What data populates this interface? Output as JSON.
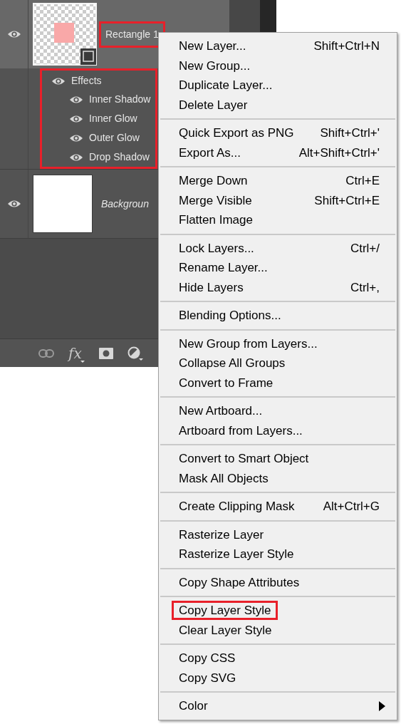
{
  "layers_panel": {
    "layers": [
      {
        "kind": "shape",
        "name": "Rectangle 1",
        "visible": true,
        "selected": true,
        "highlighted": true,
        "effects": {
          "label": "Effects",
          "visible": true,
          "highlighted": true,
          "items": [
            {
              "name": "Inner Shadow",
              "visible": true
            },
            {
              "name": "Inner Glow",
              "visible": true
            },
            {
              "name": "Outer Glow",
              "visible": true
            },
            {
              "name": "Drop Shadow",
              "visible": true
            }
          ]
        }
      },
      {
        "kind": "background",
        "name": "Backgroun",
        "visible": true,
        "selected": false,
        "highlighted": false
      }
    ],
    "footer_buttons": [
      {
        "kind": "link"
      },
      {
        "kind": "fx",
        "label": "fx"
      },
      {
        "kind": "mask"
      },
      {
        "kind": "adjustment"
      }
    ]
  },
  "context_menu": {
    "groups": [
      [
        {
          "label": "New Layer...",
          "shortcut": "Shift+Ctrl+N",
          "highlighted": false,
          "submenu": false
        },
        {
          "label": "New Group...",
          "highlighted": false,
          "submenu": false
        },
        {
          "label": "Duplicate Layer...",
          "highlighted": false,
          "submenu": false
        },
        {
          "label": "Delete Layer",
          "highlighted": false,
          "submenu": false
        }
      ],
      [
        {
          "label": "Quick Export as PNG",
          "shortcut": "Shift+Ctrl+'",
          "highlighted": false,
          "submenu": false
        },
        {
          "label": "Export As...",
          "shortcut": "Alt+Shift+Ctrl+'",
          "highlighted": false,
          "submenu": false
        }
      ],
      [
        {
          "label": "Merge Down",
          "shortcut": "Ctrl+E",
          "highlighted": false,
          "submenu": false
        },
        {
          "label": "Merge Visible",
          "shortcut": "Shift+Ctrl+E",
          "highlighted": false,
          "submenu": false
        },
        {
          "label": "Flatten Image",
          "highlighted": false,
          "submenu": false
        }
      ],
      [
        {
          "label": "Lock Layers...",
          "shortcut": "Ctrl+/",
          "highlighted": false,
          "submenu": false
        },
        {
          "label": "Rename Layer...",
          "highlighted": false,
          "submenu": false
        },
        {
          "label": "Hide Layers",
          "shortcut": "Ctrl+,",
          "highlighted": false,
          "submenu": false
        }
      ],
      [
        {
          "label": "Blending Options...",
          "highlighted": false,
          "submenu": false
        }
      ],
      [
        {
          "label": "New Group from Layers...",
          "highlighted": false,
          "submenu": false
        },
        {
          "label": "Collapse All Groups",
          "highlighted": false,
          "submenu": false
        },
        {
          "label": "Convert to Frame",
          "highlighted": false,
          "submenu": false
        }
      ],
      [
        {
          "label": "New Artboard...",
          "highlighted": false,
          "submenu": false
        },
        {
          "label": "Artboard from Layers...",
          "highlighted": false,
          "submenu": false
        }
      ],
      [
        {
          "label": "Convert to Smart Object",
          "highlighted": false,
          "submenu": false
        },
        {
          "label": "Mask All Objects",
          "highlighted": false,
          "submenu": false
        }
      ],
      [
        {
          "label": "Create Clipping Mask",
          "shortcut": "Alt+Ctrl+G",
          "highlighted": false,
          "submenu": false
        }
      ],
      [
        {
          "label": "Rasterize Layer",
          "highlighted": false,
          "submenu": false
        },
        {
          "label": "Rasterize Layer Style",
          "highlighted": false,
          "submenu": false
        }
      ],
      [
        {
          "label": "Copy Shape Attributes",
          "highlighted": false,
          "submenu": false
        }
      ],
      [
        {
          "label": "Copy Layer Style",
          "highlighted": true,
          "submenu": false
        },
        {
          "label": "Clear Layer Style",
          "highlighted": false,
          "submenu": false
        }
      ],
      [
        {
          "label": "Copy CSS",
          "highlighted": false,
          "submenu": false
        },
        {
          "label": "Copy SVG",
          "highlighted": false,
          "submenu": false
        }
      ],
      [
        {
          "label": "Color",
          "highlighted": false,
          "submenu": true
        }
      ]
    ]
  }
}
